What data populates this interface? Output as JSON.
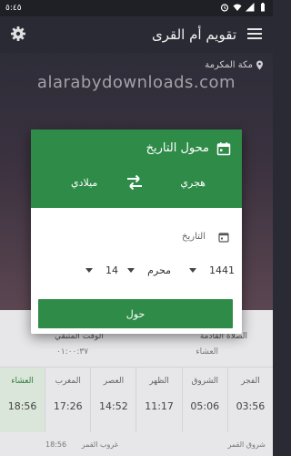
{
  "status_bar": {
    "clock": "٥:٤٥"
  },
  "app_bar": {
    "title": "تقويم أم القرى",
    "menu_icon": "menu-icon",
    "settings_icon": "gear-icon"
  },
  "location": {
    "text": "مكة المكرمة",
    "icon": "location-pin-icon"
  },
  "watermark": "alarabydownloads.com",
  "dialog": {
    "title": "محول التاريخ",
    "from_label": "هجري",
    "to_label": "ميلادي",
    "date_label": "التاريخ",
    "year": "1441",
    "month": "محرم",
    "day": "14",
    "convert_button": "حول",
    "colors": {
      "accent": "#2e8b48"
    }
  },
  "lower_panel": {
    "upcoming_label": "الصلاة القادمة",
    "upcoming_value": "العشاء",
    "remaining_label": "الوقت المتبقي",
    "remaining_value": "٠١:٠٠:٣٧",
    "prayers": [
      {
        "name": "الفجر",
        "time": "03:56"
      },
      {
        "name": "الشروق",
        "time": "05:06"
      },
      {
        "name": "الظهر",
        "time": "11:17"
      },
      {
        "name": "العصر",
        "time": "14:52"
      },
      {
        "name": "المغرب",
        "time": "17:26"
      },
      {
        "name": "العشاء",
        "time": "18:56"
      }
    ],
    "extras": {
      "moonrise_label": "شروق القمر",
      "moonset_label": "غروب القمر",
      "moonset_time": "18:56"
    }
  }
}
